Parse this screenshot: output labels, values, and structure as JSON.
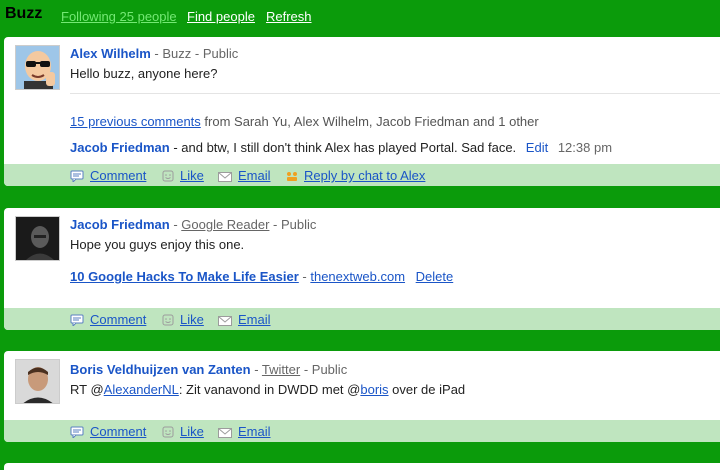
{
  "topbar": {
    "title": "Buzz",
    "following": "Following 25 people",
    "find": "Find people",
    "refresh": "Refresh"
  },
  "posts": [
    {
      "author": "Alex Wilhelm",
      "source": "Buzz",
      "visibility": "Public",
      "text": "Hello buzz, anyone here?",
      "prev_comments_link": "15 previous comments",
      "prev_comments_from": "from Sarah Yu, Alex Wilhelm, Jacob Friedman and 1 other",
      "comment": {
        "author": "Jacob Friedman",
        "text": "- and btw, I still don't think Alex has played Portal. Sad face.",
        "edit": "Edit",
        "time": "12:38 pm"
      },
      "actions": {
        "comment": "Comment",
        "like": "Like",
        "email": "Email",
        "reply_chat": "Reply by chat to Alex"
      }
    },
    {
      "author": "Jacob Friedman",
      "source": "Google Reader",
      "visibility": "Public",
      "text": "Hope you guys enjoy this one.",
      "link_title": "10 Google Hacks To Make Life Easier",
      "link_domain": "thenextweb.com",
      "delete": "Delete",
      "actions": {
        "comment": "Comment",
        "like": "Like",
        "email": "Email"
      }
    },
    {
      "author": "Boris Veldhuijzen van Zanten",
      "source": "Twitter",
      "visibility": "Public",
      "text_rt": "RT @",
      "mention1": "AlexanderNL",
      "text_mid": ": Zit vanavond in DWDD met @",
      "mention2": "boris",
      "text_end": " over de iPad",
      "actions": {
        "comment": "Comment",
        "like": "Like",
        "email": "Email"
      }
    }
  ],
  "separator": " - ",
  "colors": {
    "page_bg": "#0b9b0b",
    "footer_bg": "#bfe5bf",
    "link": "#1a55c7",
    "following_link": "#74e874"
  }
}
